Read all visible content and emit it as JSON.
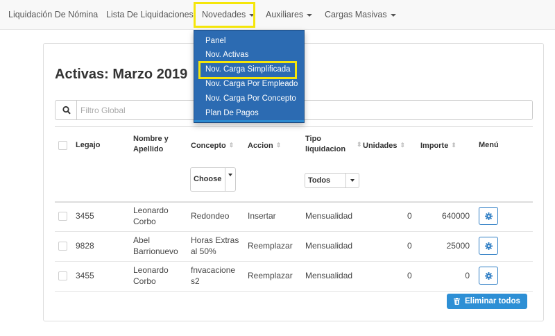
{
  "nav": {
    "items": [
      {
        "label": "Liquidación De Nómina",
        "has_caret": false
      },
      {
        "label": "Lista De Liquidaciones",
        "has_caret": false
      },
      {
        "label": "Novedades",
        "has_caret": true
      },
      {
        "label": "Auxiliares",
        "has_caret": true
      },
      {
        "label": "Cargas Masivas",
        "has_caret": true
      }
    ]
  },
  "dropdown": {
    "items": [
      {
        "label": "Panel"
      },
      {
        "label": "Nov. Activas"
      },
      {
        "label": "Nov. Carga Simplificada"
      },
      {
        "label": "Nov. Carga Por Empleado"
      },
      {
        "label": "Nov. Carga Por Concepto"
      },
      {
        "label": "Plan De Pagos"
      }
    ],
    "highlighted": "Nov. Carga Simplificada"
  },
  "page": {
    "title": "Activas: Marzo 2019"
  },
  "search": {
    "placeholder": "Filtro Global",
    "icon": "search-icon"
  },
  "table": {
    "headers": {
      "legajo": "Legajo",
      "nombre_1": "Nombre y",
      "nombre_2": "Apellido",
      "concepto": "Concepto",
      "accion": "Accion",
      "tipo_1": "Tipo",
      "tipo_2": "liquidacion",
      "unidades": "Unidades",
      "importe": "Importe",
      "menu": "Menú"
    },
    "filters": {
      "concepto_selected": "Choose",
      "tipo_selected": "Todos"
    },
    "rows": [
      {
        "legajo": "3455",
        "nombre_1": "Leonardo",
        "nombre_2": "Corbo",
        "concepto_1": "Redondeo",
        "concepto_2": "",
        "accion": "Insertar",
        "tipo": "Mensualidad",
        "unidades": "0",
        "importe": "640000"
      },
      {
        "legajo": "9828",
        "nombre_1": "Abel",
        "nombre_2": "Barrionuevo",
        "concepto_1": "Horas Extras",
        "concepto_2": "al 50%",
        "accion": "Reemplazar",
        "tipo": "Mensualidad",
        "unidades": "0",
        "importe": "25000"
      },
      {
        "legajo": "3455",
        "nombre_1": "Leonardo",
        "nombre_2": "Corbo",
        "concepto_1": "fnvacacione",
        "concepto_2": "s2",
        "accion": "Reemplazar",
        "tipo": "Mensualidad",
        "unidades": "0",
        "importe": "0"
      }
    ]
  },
  "actions": {
    "delete_all_label": "Eliminar todos"
  },
  "colors": {
    "dropdown_bg": "#2c6bb2",
    "highlight": "#f5e60a",
    "primary_button": "#2d8fd5"
  }
}
